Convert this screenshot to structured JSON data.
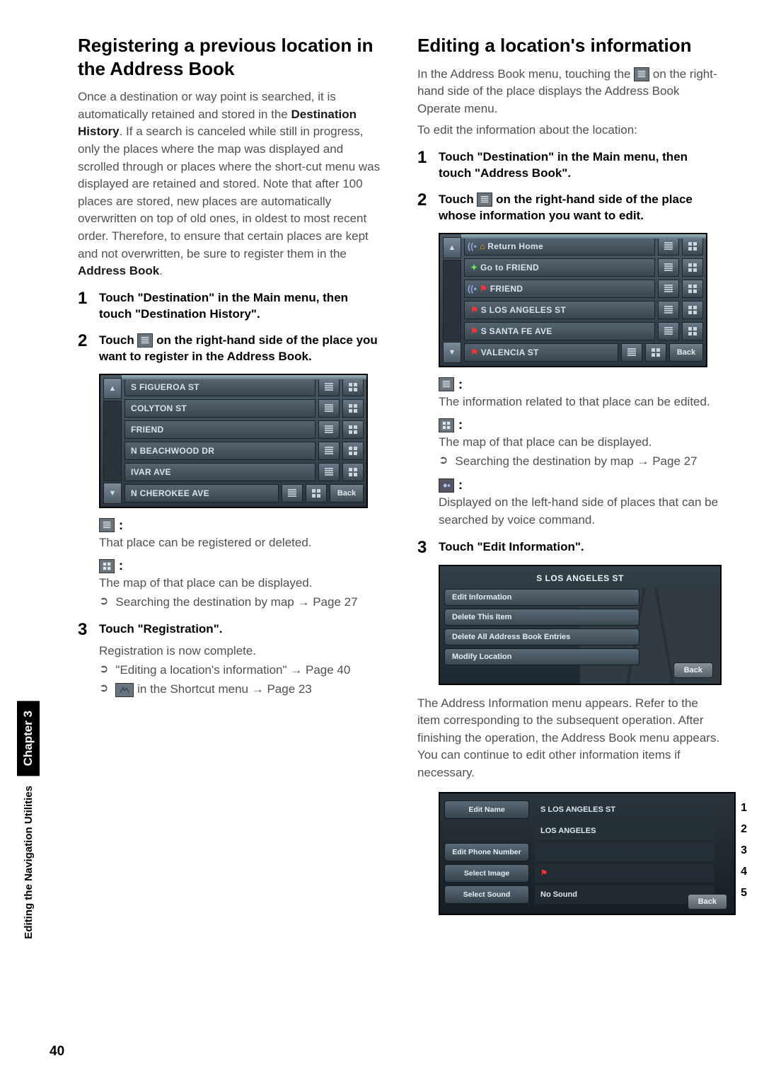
{
  "page": {
    "number": "40"
  },
  "sidebar": {
    "chapter": "Chapter 3",
    "subtitle": "Editing the Navigation Utilities"
  },
  "left": {
    "heading": "Registering a previous location in the Address Book",
    "intro_a": "Once a destination or way point is searched, it is automatically retained and stored in the ",
    "intro_bold1": "Destination History",
    "intro_b": ". If a search is canceled while still in progress, only the places where the map was displayed and scrolled through or places where the short-cut menu was displayed are retained and stored. Note that after 100 places are stored, new places are automatically overwritten on top of old ones, in oldest to most recent order. Therefore, to ensure that certain places are kept and not overwritten, be sure to register them in the ",
    "intro_bold2": "Address Book",
    "intro_c": ".",
    "step1": "Touch \"Destination\" in the Main menu, then touch \"Destination History\".",
    "step2": "Touch      on the right-hand side of the place you want to register in the Address Book.",
    "listItems": [
      "S FIGUEROA ST",
      "COLYTON ST",
      "FRIEND",
      "N BEACHWOOD DR",
      "IVAR AVE",
      "N CHEROKEE AVE"
    ],
    "back": "Back",
    "iconA_note": "That place can be registered or deleted.",
    "iconB_note": "The map of that place can be displayed.",
    "ref1": "Searching the destination by map ",
    "ref1_pg": "Page 27",
    "step3": "Touch \"Registration\".",
    "step3_note": "Registration is now complete.",
    "ref2": "\"Editing a location's information\" ",
    "ref2_pg": "Page 40",
    "ref3": " in the Shortcut menu ",
    "ref3_pg": "Page 23"
  },
  "right": {
    "heading": "Editing a location's information",
    "intro_a": "In the Address Book menu, touching the ",
    "intro_b": " on the right-hand side of the place displays the Address Book Operate menu.",
    "intro_c": "To edit the information about the location:",
    "step1": "Touch \"Destination\" in the Main menu, then touch \"Address Book\".",
    "step2": "Touch      on the right-hand side of the place whose information you want to edit.",
    "listItems": [
      "Return Home",
      "Go to FRIEND",
      "FRIEND",
      "S LOS ANGELES ST",
      "S SANTA FE AVE",
      "VALENCIA ST"
    ],
    "back": "Back",
    "iconA_note": "The information related to that place can be edited.",
    "iconB_note": "The map of that place can be displayed.",
    "ref1": "Searching the destination by map ",
    "ref1_pg": "Page 27",
    "iconC_note": "Displayed on the left-hand side of places that can be searched by voice command.",
    "step3": "Touch \"Edit Information\".",
    "menu_title": "S LOS ANGELES ST",
    "menu_items": [
      "Edit Information",
      "Delete This Item",
      "Delete All Address Book Entries",
      "Modify Location"
    ],
    "menu_back": "Back",
    "after": "The Address Information menu appears. Refer to the item corresponding to the subsequent operation. After finishing the operation, the Address Book menu appears. You can continue to edit other information items if necessary.",
    "edit_rows": [
      {
        "btn": "Edit Name",
        "val": "S LOS ANGELES ST",
        "n": "1"
      },
      {
        "btn": "",
        "val": "LOS ANGELES",
        "n": "2"
      },
      {
        "btn": "Edit Phone Number",
        "val": "",
        "n": "3"
      },
      {
        "btn": "Select Image",
        "val": "",
        "n": "4"
      },
      {
        "btn": "Select Sound",
        "val": "No Sound",
        "n": "5"
      }
    ],
    "edit_back": "Back"
  }
}
